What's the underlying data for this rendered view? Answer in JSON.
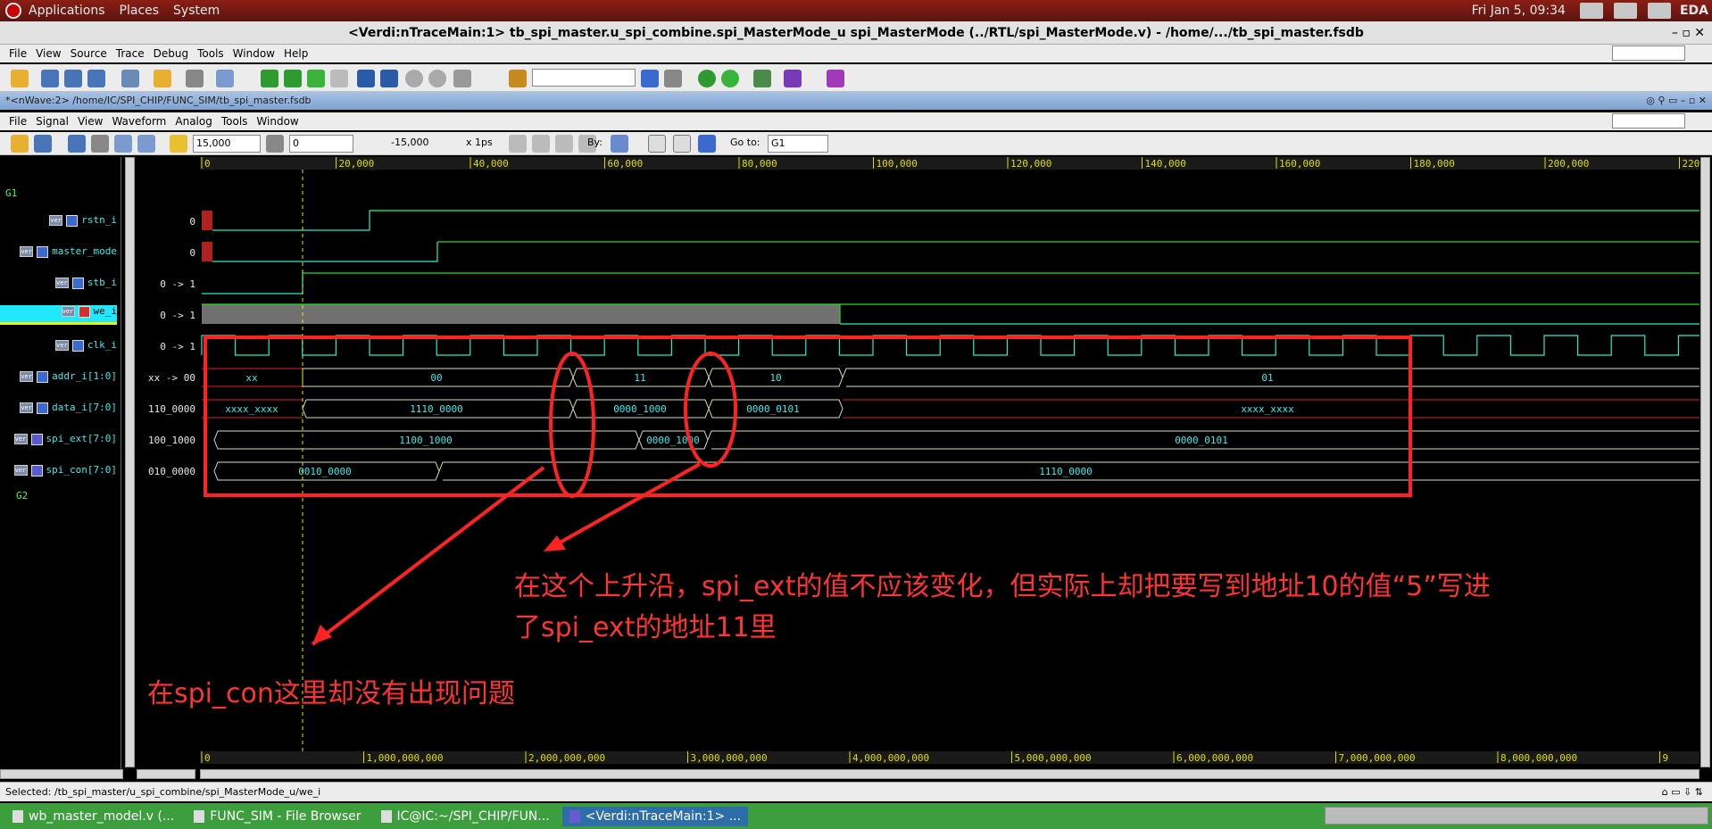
{
  "desktop": {
    "menu": [
      "Applications",
      "Places",
      "System"
    ],
    "clock": "Fri Jan  5, 09:34",
    "user": "EDA"
  },
  "window": {
    "title": "<Verdi:nTraceMain:1> tb_spi_master.u_spi_combine.spi_MasterMode_u spi_MasterMode (../RTL/spi_MasterMode.v) - /home/.../tb_spi_master.fsdb",
    "main_menu": [
      "File",
      "View",
      "Source",
      "Trace",
      "Debug",
      "Tools",
      "Window",
      "Help"
    ]
  },
  "nwave": {
    "subtitle": "*<nWave:2> /home/IC/SPI_CHIP/FUNC_SIM/tb_spi_master.fsdb",
    "menu": [
      "File",
      "Signal",
      "View",
      "Waveform",
      "Analog",
      "Tools",
      "Window"
    ],
    "cursor_time": "15,000",
    "marker_time": "0",
    "delta": "-15,000",
    "time_unit": "x 1ps",
    "by_label": "By:",
    "goto_label": "Go to:",
    "goto_value": "G1"
  },
  "ruler_top": [
    "0",
    "20,000",
    "40,000",
    "60,000",
    "80,000",
    "100,000",
    "120,000",
    "140,000",
    "160,000",
    "180,000",
    "200,000",
    "220"
  ],
  "ruler_bottom": [
    "0",
    "1,000,000,000",
    "2,000,000,000",
    "3,000,000,000",
    "4,000,000,000",
    "5,000,000,000",
    "6,000,000,000",
    "7,000,000,000",
    "8,000,000,000",
    "9"
  ],
  "groups": {
    "g1": "G1",
    "g2": "G2"
  },
  "signals": [
    {
      "name": "rstn_i",
      "value": "0"
    },
    {
      "name": "master_mode",
      "value": "0"
    },
    {
      "name": "stb_i",
      "value": "0 -> 1"
    },
    {
      "name": "we_i",
      "value": "0 -> 1"
    },
    {
      "name": "clk_i",
      "value": "0 -> 1"
    },
    {
      "name": "addr_i[1:0]",
      "value": "xx -> 00"
    },
    {
      "name": "data_i[7:0]",
      "value": "110_0000"
    },
    {
      "name": "spi_ext[7:0]",
      "value": "100_1000"
    },
    {
      "name": "spi_con[7:0]",
      "value": "010_0000"
    }
  ],
  "bus_labels": {
    "addr": [
      "xx",
      "00",
      "11",
      "10",
      "01"
    ],
    "data": [
      "xxxx_xxxx",
      "1110_0000",
      "0000_1000",
      "0000_0101",
      "xxxx_xxxx"
    ],
    "spi_ext": [
      "1100_1000",
      "0000_1000",
      "0000_0101"
    ],
    "spi_con": [
      "0010_0000",
      "1110_0000"
    ]
  },
  "annotations": {
    "note1_line1": "在这个上升沿，spi_ext的值不应该变化，但实际上却把要写到地址10的值“5”写进",
    "note1_line2": "了spi_ext的地址11里",
    "note2": "在spi_con这里却没有出现问题"
  },
  "status": "Selected: /tb_spi_master/u_spi_combine/spi_MasterMode_u/we_i",
  "taskbar": [
    "wb_master_model.v (...",
    "FUNC_SIM - File Browser",
    "IC@IC:~/SPI_CHIP/FUN...",
    "<Verdi:nTraceMain:1> ..."
  ]
}
